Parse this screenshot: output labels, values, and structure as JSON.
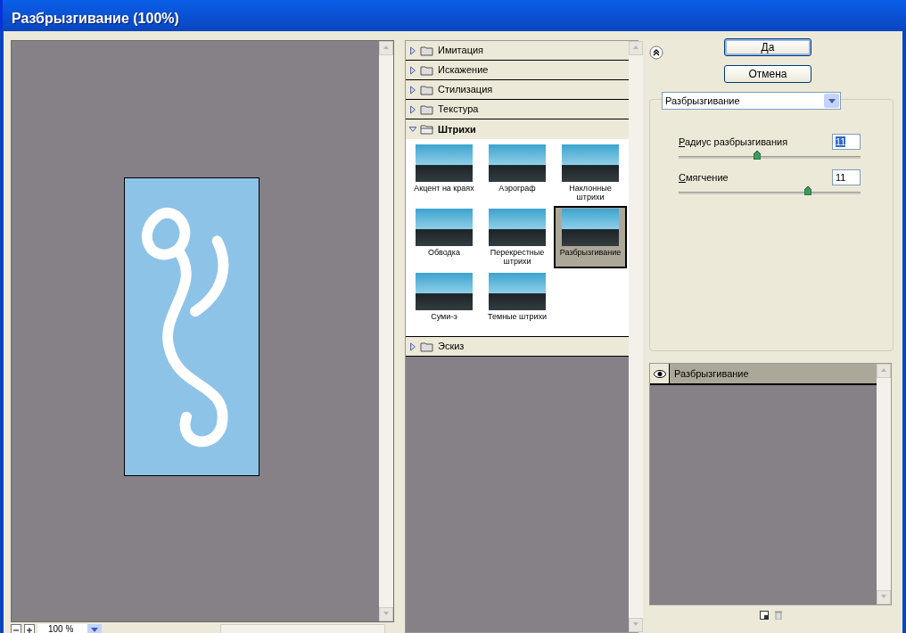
{
  "window": {
    "title": "Разбрызгивание (100%)"
  },
  "preview": {
    "zoom": "100 %"
  },
  "categories": [
    {
      "label": "Имитация",
      "expanded": false
    },
    {
      "label": "Искажение",
      "expanded": false
    },
    {
      "label": "Стилизация",
      "expanded": false
    },
    {
      "label": "Текстура",
      "expanded": false
    },
    {
      "label": "Штрихи",
      "expanded": true,
      "filters": [
        {
          "label": "Акцент на краях",
          "selected": false
        },
        {
          "label": "Аэрограф",
          "selected": false
        },
        {
          "label": "Наклонные штрихи",
          "selected": false
        },
        {
          "label": "Обводка",
          "selected": false
        },
        {
          "label": "Перекрестные штрихи",
          "selected": false
        },
        {
          "label": "Разбрызгивание",
          "selected": true
        },
        {
          "label": "Суми-э",
          "selected": false
        },
        {
          "label": "Темные штрихи",
          "selected": false
        }
      ]
    },
    {
      "label": "Эскиз",
      "expanded": false
    }
  ],
  "buttons": [
    {
      "label": "Да",
      "default": true
    },
    {
      "label": "Отмена",
      "default": false
    }
  ],
  "filter_select": {
    "value": "Разбрызгивание"
  },
  "params": [
    {
      "label": "Радиус разбрызгивания",
      "value": "11",
      "selected": true,
      "level": 0.43
    },
    {
      "label": "Смягчение",
      "value": "11",
      "selected": false,
      "level": 0.71
    }
  ],
  "layers": [
    {
      "label": "Разбрызгивание",
      "visible": true
    }
  ]
}
